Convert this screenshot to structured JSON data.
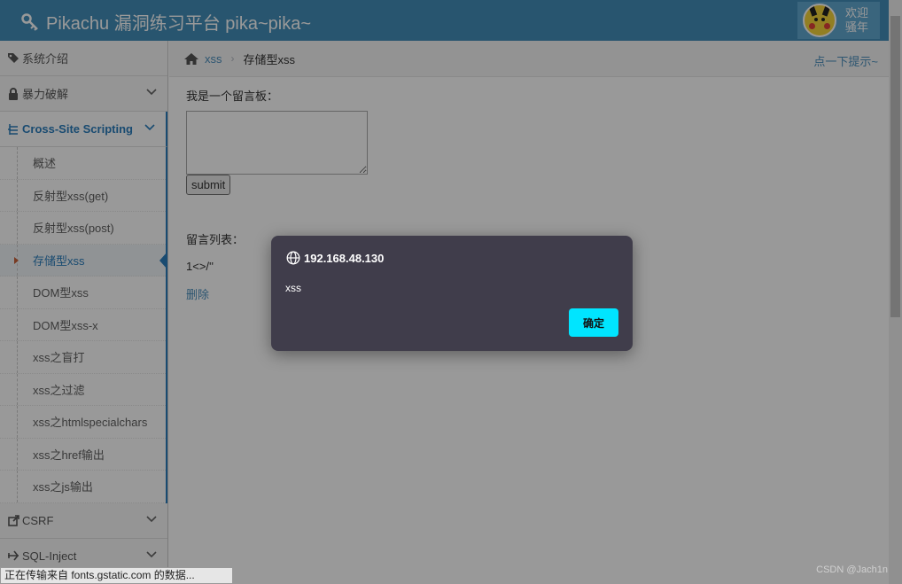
{
  "header": {
    "title": "Pikachu 漏洞练习平台 pika~pika~",
    "welcome_line1": "欢迎",
    "welcome_line2": "骚年"
  },
  "sidebar": {
    "items": [
      {
        "label": "系统介绍",
        "icon": "tags-icon"
      },
      {
        "label": "暴力破解",
        "icon": "lock-icon"
      },
      {
        "label": "Cross-Site Scripting",
        "icon": "list-icon"
      },
      {
        "label": "CSRF",
        "icon": "share-icon"
      },
      {
        "label": "SQL-Inject",
        "icon": "plane-icon"
      }
    ],
    "xss_submenu": [
      "概述",
      "反射型xss(get)",
      "反射型xss(post)",
      "存储型xss",
      "DOM型xss",
      "DOM型xss-x",
      "xss之盲打",
      "xss之过滤",
      "xss之htmlspecialchars",
      "xss之href输出",
      "xss之js输出"
    ]
  },
  "breadcrumb": {
    "root": "xss",
    "current": "存储型xss",
    "hint": "点一下提示~"
  },
  "content": {
    "board_label": "我是一个留言板：",
    "textarea_value": "",
    "submit_label": "submit",
    "list_title": "留言列表：",
    "message_text": "1<>/''",
    "delete_label": "删除"
  },
  "dialog": {
    "origin": "192.168.48.130",
    "message": "xss",
    "ok_label": "确定"
  },
  "status_bar": "正在传输来自 fonts.gstatic.com 的数据...",
  "watermark": "CSDN @Jach1n",
  "colors": {
    "header_bg": "#438eb9",
    "accent": "#2b7dbc",
    "dialog_bg": "#403d4b",
    "ok_button": "#00e5ff"
  }
}
